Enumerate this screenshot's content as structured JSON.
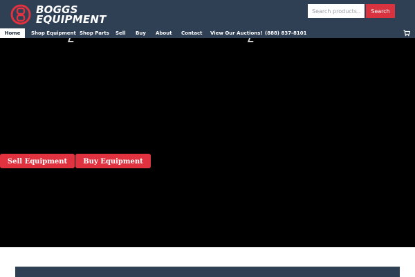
{
  "brand": {
    "line1": "BOGGS",
    "line2": "EQUIPMENT"
  },
  "search": {
    "placeholder": "Search products…",
    "button_label": "Search"
  },
  "nav": {
    "items": [
      {
        "label": "Home",
        "active": true
      },
      {
        "label": "Shop Equipment"
      },
      {
        "label": "Shop Parts"
      },
      {
        "label": "Sell"
      },
      {
        "label": "Buy"
      },
      {
        "label": "About"
      },
      {
        "label": "Contact"
      },
      {
        "label": "View Our Auctions!"
      },
      {
        "label": "(888) 837-8101"
      }
    ]
  },
  "hero": {
    "sell_label": "Sell Equipment",
    "buy_label": "Buy Equipment"
  },
  "icons": {
    "cart": "cart-icon",
    "logo": "boggs-logo-icon"
  },
  "colors": {
    "header": "#2f3f54",
    "accent": "#d9333f",
    "hero": "#000000"
  }
}
